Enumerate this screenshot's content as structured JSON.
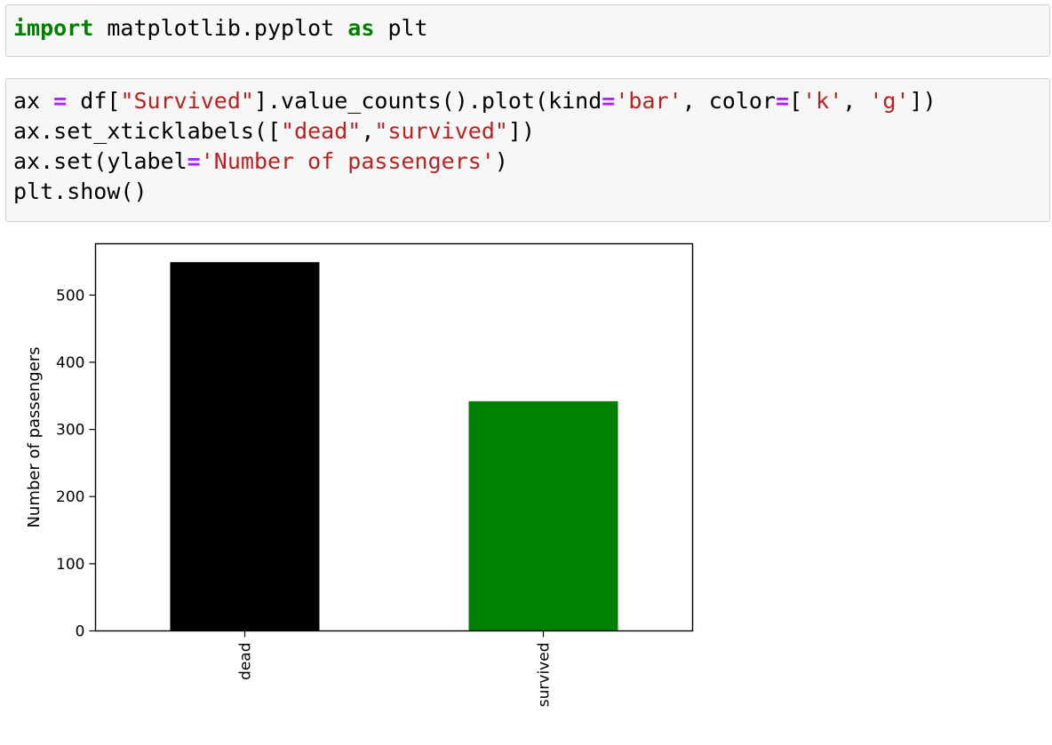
{
  "cells": [
    {
      "lines": [
        [
          {
            "t": "import",
            "c": "kw"
          },
          {
            "t": " matplotlib.pyplot ",
            "c": "plain"
          },
          {
            "t": "as",
            "c": "kw"
          },
          {
            "t": " plt",
            "c": "plain"
          }
        ]
      ]
    },
    {
      "lines": [
        [
          {
            "t": "ax ",
            "c": "plain"
          },
          {
            "t": "=",
            "c": "op"
          },
          {
            "t": " df[",
            "c": "plain"
          },
          {
            "t": "\"Survived\"",
            "c": "str"
          },
          {
            "t": "].value_counts().plot(kind",
            "c": "plain"
          },
          {
            "t": "=",
            "c": "op"
          },
          {
            "t": "'bar'",
            "c": "str"
          },
          {
            "t": ", color",
            "c": "plain"
          },
          {
            "t": "=",
            "c": "op"
          },
          {
            "t": "[",
            "c": "plain"
          },
          {
            "t": "'k'",
            "c": "str"
          },
          {
            "t": ", ",
            "c": "plain"
          },
          {
            "t": "'g'",
            "c": "str"
          },
          {
            "t": "])",
            "c": "plain"
          }
        ],
        [
          {
            "t": "ax.set_xticklabels([",
            "c": "plain"
          },
          {
            "t": "\"dead\"",
            "c": "str"
          },
          {
            "t": ",",
            "c": "plain"
          },
          {
            "t": "\"survived\"",
            "c": "str"
          },
          {
            "t": "])",
            "c": "plain"
          }
        ],
        [
          {
            "t": "ax.set(ylabel",
            "c": "plain"
          },
          {
            "t": "=",
            "c": "op"
          },
          {
            "t": "'Number of passengers'",
            "c": "str"
          },
          {
            "t": ")",
            "c": "plain"
          }
        ],
        [
          {
            "t": "plt.show()",
            "c": "plain"
          }
        ]
      ]
    }
  ],
  "colors": {
    "keyword": "#008000",
    "operator": "#aa22ff",
    "string": "#ba2121"
  },
  "chart_data": {
    "type": "bar",
    "categories": [
      "dead",
      "survived"
    ],
    "values": [
      549,
      342
    ],
    "colors": [
      "#000000",
      "#008000"
    ],
    "xlabel": "",
    "ylabel": "Number of passengers",
    "ylim": [
      0,
      576.45
    ],
    "yticks": [
      0,
      100,
      200,
      300,
      400,
      500
    ],
    "xtick_rotation": 90,
    "grid": false
  }
}
